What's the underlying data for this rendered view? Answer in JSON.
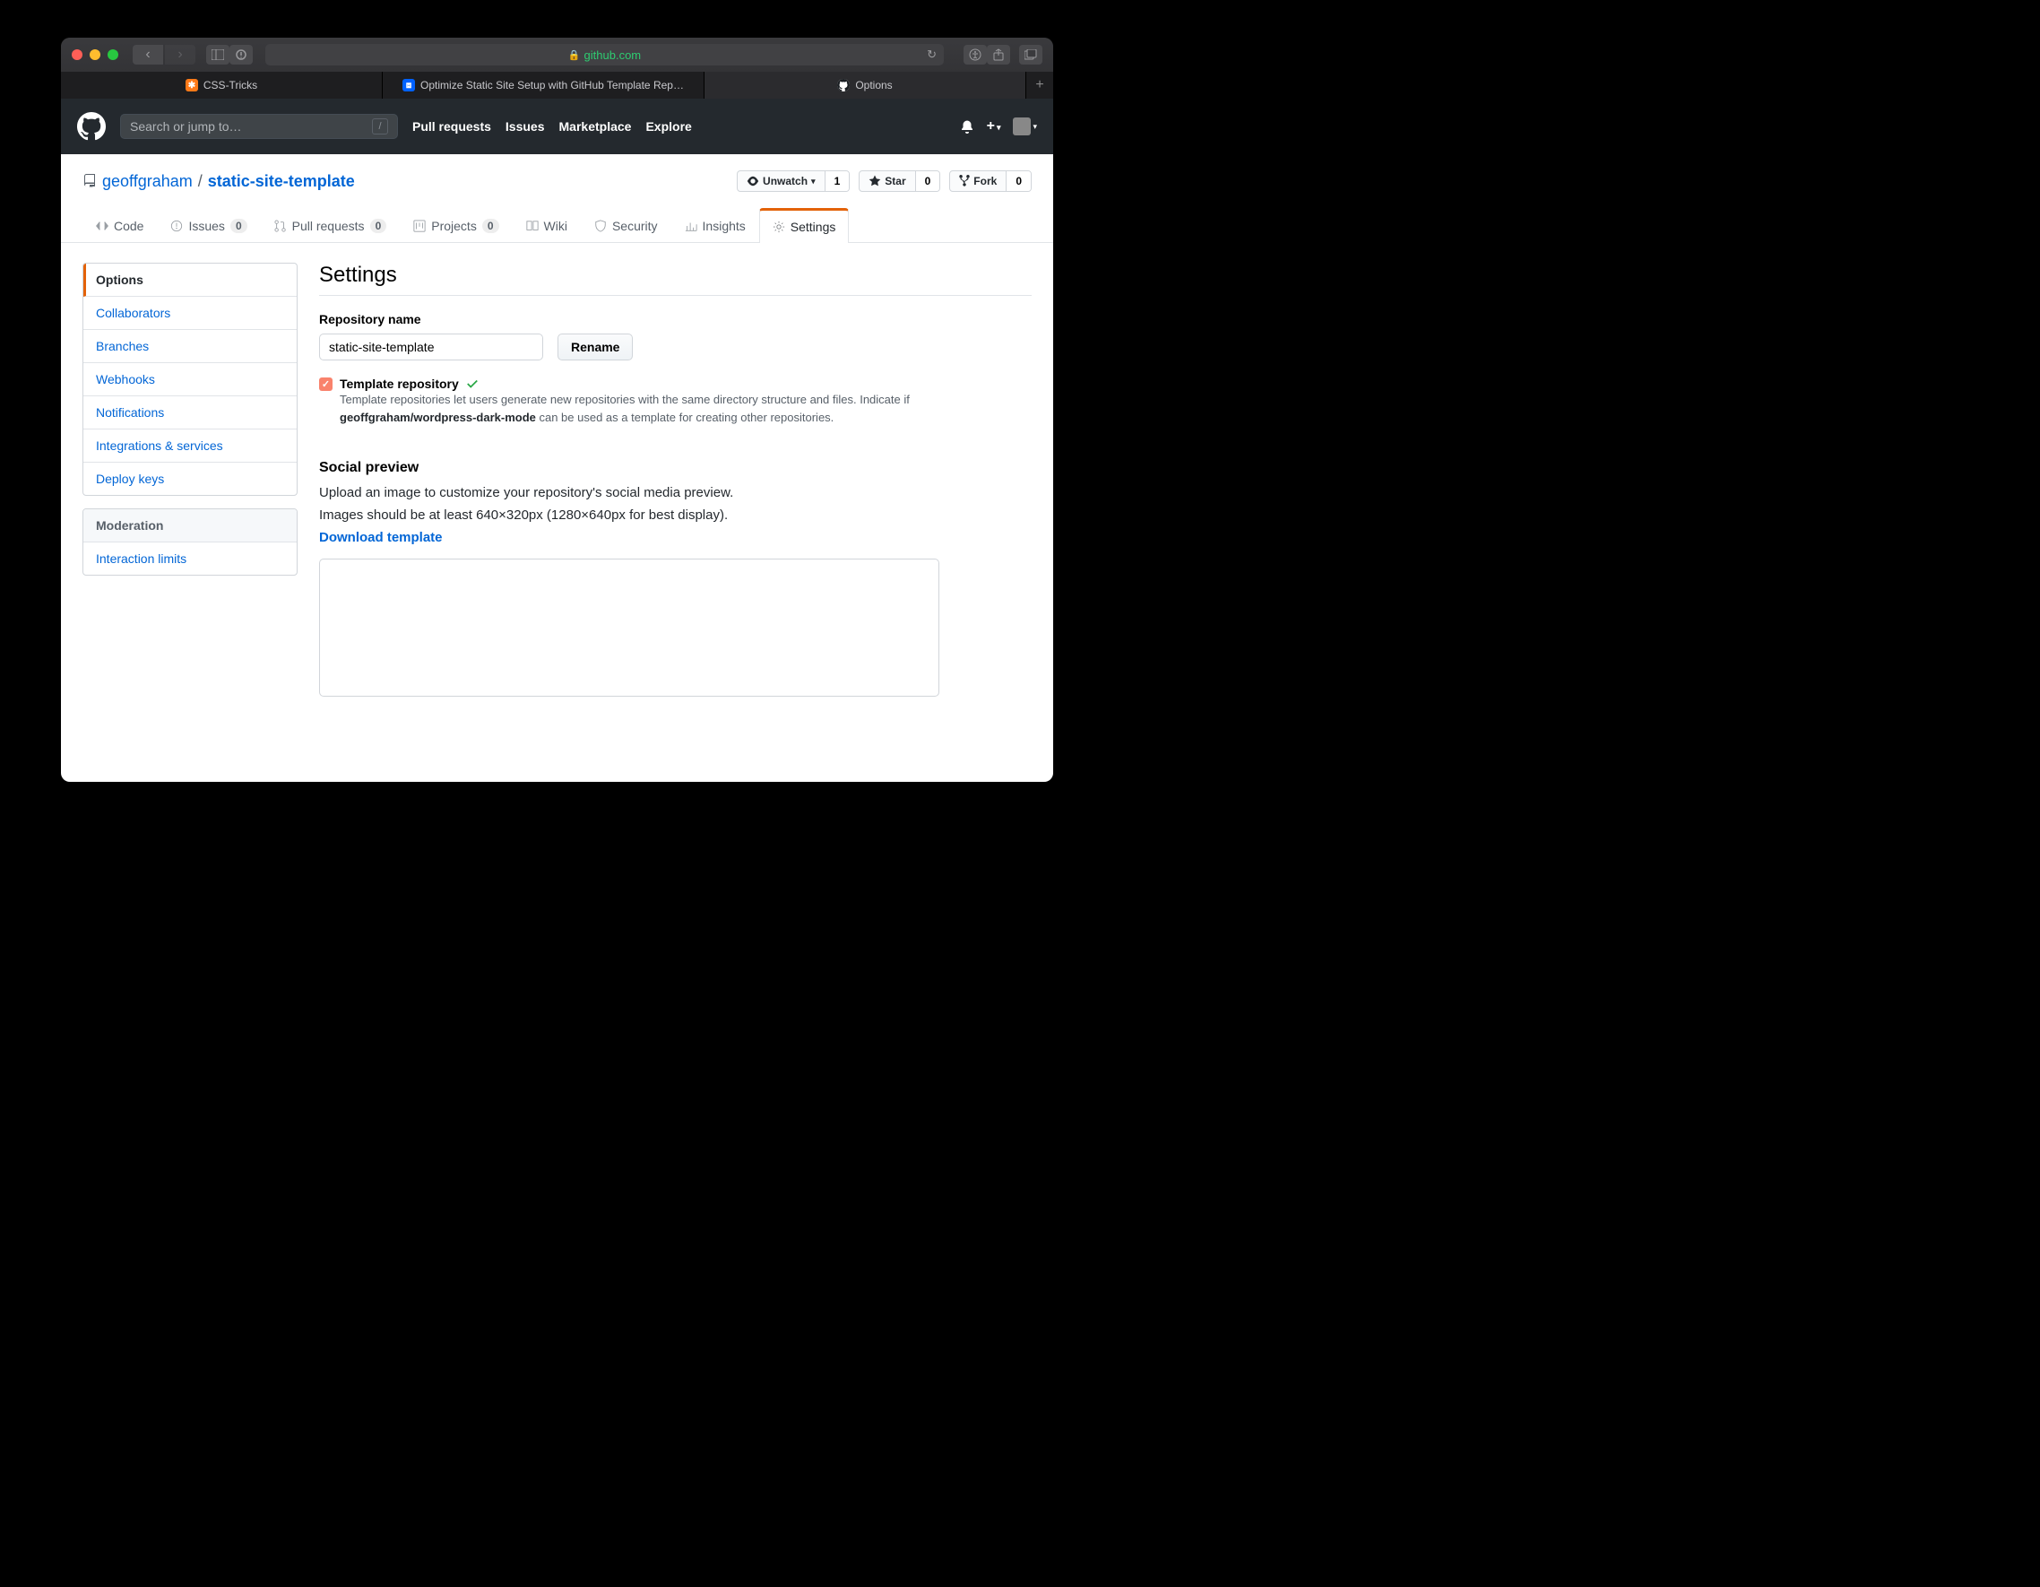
{
  "browser": {
    "url_domain": "github.com",
    "tabs": [
      {
        "label": "CSS-Tricks",
        "icon_bg": "#ff7a18",
        "icon_char": "✱"
      },
      {
        "label": "Optimize Static Site Setup with GitHub Template Rep…",
        "icon_bg": "#0062ff",
        "icon_char": "⬇"
      },
      {
        "label": "Options",
        "icon_bg": "#fff",
        "icon_char": ""
      }
    ]
  },
  "header": {
    "search_placeholder": "Search or jump to…",
    "nav": [
      "Pull requests",
      "Issues",
      "Marketplace",
      "Explore"
    ]
  },
  "repo": {
    "owner": "geoffgraham",
    "name": "static-site-template",
    "watch_label": "Unwatch",
    "watch_count": "1",
    "star_label": "Star",
    "star_count": "0",
    "fork_label": "Fork",
    "fork_count": "0",
    "tabs": [
      {
        "label": "Code"
      },
      {
        "label": "Issues",
        "count": "0"
      },
      {
        "label": "Pull requests",
        "count": "0"
      },
      {
        "label": "Projects",
        "count": "0"
      },
      {
        "label": "Wiki"
      },
      {
        "label": "Security"
      },
      {
        "label": "Insights"
      },
      {
        "label": "Settings",
        "active": true
      }
    ]
  },
  "sidebar": {
    "menu1": [
      "Options",
      "Collaborators",
      "Branches",
      "Webhooks",
      "Notifications",
      "Integrations & services",
      "Deploy keys"
    ],
    "menu2_header": "Moderation",
    "menu2": [
      "Interaction limits"
    ]
  },
  "settings": {
    "title": "Settings",
    "repo_name_label": "Repository name",
    "repo_name_value": "static-site-template",
    "rename_btn": "Rename",
    "template_cb_label": "Template repository",
    "template_help_1": "Template repositories let users generate new repositories with the same directory structure and files. Indicate if ",
    "template_help_bold": "geoffgraham/wordpress-dark-mode",
    "template_help_2": " can be used as a template for creating other repositories.",
    "social_title": "Social preview",
    "social_p1": "Upload an image to customize your repository's social media preview.",
    "social_p2": "Images should be at least 640×320px (1280×640px for best display).",
    "social_link": "Download template"
  }
}
